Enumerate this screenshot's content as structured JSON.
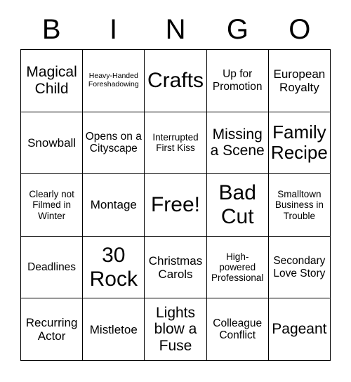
{
  "header": {
    "letters": [
      "B",
      "I",
      "N",
      "G",
      "O"
    ]
  },
  "grid": {
    "rows": 5,
    "columns": 5,
    "border_color": "#000000",
    "background_color": "#ffffff",
    "cells": [
      {
        "text": "Magical Child",
        "size": "l"
      },
      {
        "text": "Heavy-Handed Foreshadowing",
        "size": "xs"
      },
      {
        "text": "Crafts",
        "size": "xxl"
      },
      {
        "text": "Up for Promotion",
        "size": "m"
      },
      {
        "text": "European Royalty",
        "size": "ml"
      },
      {
        "text": "Snowball",
        "size": "ml"
      },
      {
        "text": "Opens on a Cityscape",
        "size": "m"
      },
      {
        "text": "Interrupted First Kiss",
        "size": "s"
      },
      {
        "text": "Missing a Scene",
        "size": "l"
      },
      {
        "text": "Family Recipe",
        "size": "xl"
      },
      {
        "text": "Clearly not Filmed in Winter",
        "size": "s"
      },
      {
        "text": "Montage",
        "size": "ml"
      },
      {
        "text": "Free!",
        "size": "xxl"
      },
      {
        "text": "Bad Cut",
        "size": "xxl"
      },
      {
        "text": "Smalltown Business in Trouble",
        "size": "s"
      },
      {
        "text": "Deadlines",
        "size": "m"
      },
      {
        "text": "30 Rock",
        "size": "xxl"
      },
      {
        "text": "Christmas Carols",
        "size": "ml"
      },
      {
        "text": "High-powered Professional",
        "size": "s"
      },
      {
        "text": "Secondary Love Story",
        "size": "m"
      },
      {
        "text": "Recurring Actor",
        "size": "ml"
      },
      {
        "text": "Mistletoe",
        "size": "ml"
      },
      {
        "text": "Lights blow a Fuse",
        "size": "l"
      },
      {
        "text": "Colleague Conflict",
        "size": "m"
      },
      {
        "text": "Pageant",
        "size": "l"
      }
    ]
  }
}
